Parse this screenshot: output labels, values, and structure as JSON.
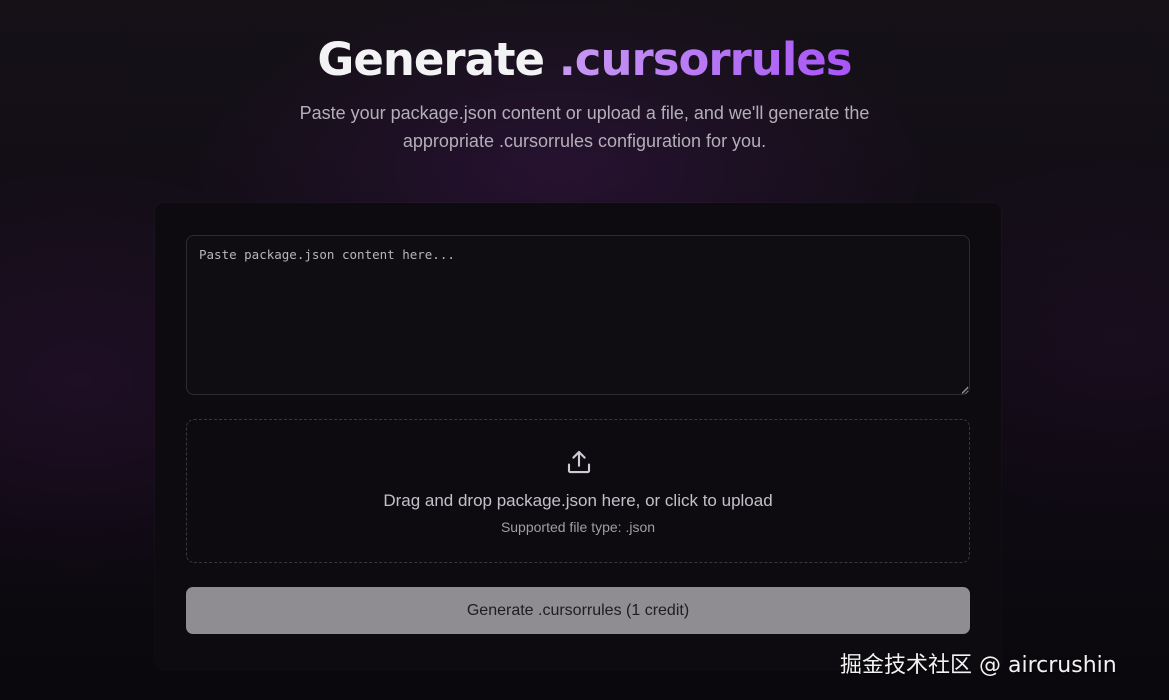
{
  "header": {
    "title_plain": "Generate",
    "title_accent": ".cursorrules",
    "subtitle_line1": "Paste your package.json content or upload a file, and we'll generate the",
    "subtitle_line2": "appropriate .cursorrules configuration for you."
  },
  "editor": {
    "placeholder": "Paste package.json content here...",
    "value": ""
  },
  "upload": {
    "icon": "upload-icon",
    "label": "Drag and drop package.json here, or click to upload",
    "hint": "Supported file type: .json"
  },
  "actions": {
    "generate_label": "Generate .cursorrules (1 credit)"
  },
  "watermark": {
    "text": "掘金技术社区 @ aircrushin"
  },
  "colors": {
    "accent_start": "#c79af2",
    "accent_end": "#a855f7",
    "button_bg": "#8f8d91",
    "card_bg": "#0d0b0f"
  }
}
